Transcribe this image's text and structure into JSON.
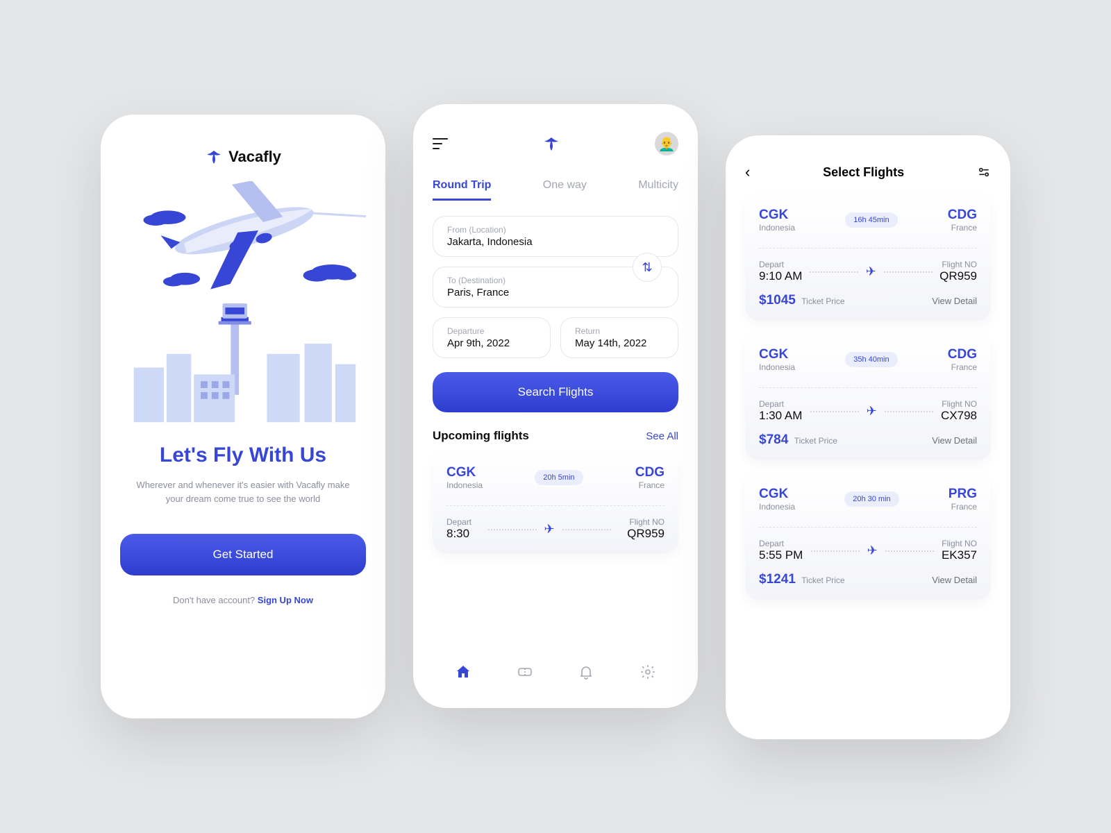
{
  "screen1": {
    "brand": "Vacafly",
    "title": "Let's Fly With Us",
    "subtitle": "Wherever and whenever it's easier with Vacafly make your dream come true to see the world",
    "cta": "Get Started",
    "footer_prefix": "Don't have account? ",
    "footer_link": "Sign Up Now"
  },
  "screen2": {
    "tabs": {
      "t0": "Round Trip",
      "t1": "One way",
      "t2": "Multicity"
    },
    "from_label": "From (Location)",
    "from_value": "Jakarta, Indonesia",
    "to_label": "To (Destination)",
    "to_value": "Paris, France",
    "dep_label": "Departure",
    "dep_value": "Apr 9th, 2022",
    "ret_label": "Return",
    "ret_value": "May 14th, 2022",
    "search": "Search Flights",
    "upcoming": "Upcoming flights",
    "see_all": "See All",
    "card": {
      "from_code": "CGK",
      "from_country": "Indonesia",
      "to_code": "CDG",
      "to_country": "France",
      "duration": "20h 5min",
      "depart_lab": "Depart",
      "depart_val": "8:30",
      "flight_lab": "Flight NO",
      "flight_val": "QR959"
    }
  },
  "screen3": {
    "title": "Select Flights",
    "labels": {
      "depart": "Depart",
      "flight": "Flight NO",
      "price": "Ticket Price",
      "detail": "View Detail"
    },
    "flights": [
      {
        "from_code": "CGK",
        "from_country": "Indonesia",
        "to_code": "CDG",
        "to_country": "France",
        "duration": "16h 45min",
        "depart": "9:10 AM",
        "flight_no": "QR959",
        "price": "$1045"
      },
      {
        "from_code": "CGK",
        "from_country": "Indonesia",
        "to_code": "CDG",
        "to_country": "France",
        "duration": "35h 40min",
        "depart": "1:30 AM",
        "flight_no": "CX798",
        "price": "$784"
      },
      {
        "from_code": "CGK",
        "from_country": "Indonesia",
        "to_code": "PRG",
        "to_country": "France",
        "duration": "20h 30 min",
        "depart": "5:55 PM",
        "flight_no": "EK357",
        "price": "$1241"
      }
    ]
  }
}
